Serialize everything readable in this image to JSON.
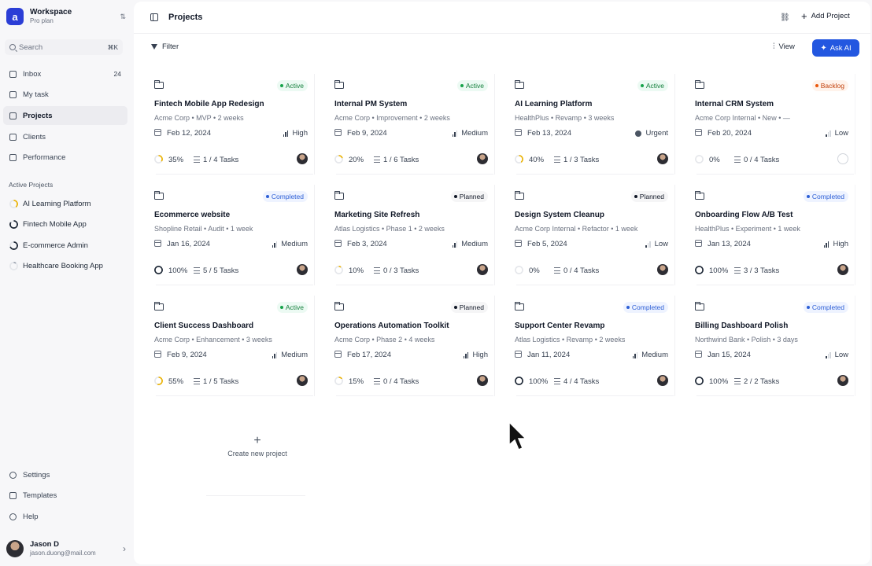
{
  "workspace": {
    "name": "Workspace",
    "plan": "Pro plan"
  },
  "search": {
    "placeholder": "Search",
    "shortcut": "⌘K"
  },
  "nav": [
    {
      "label": "Inbox",
      "count": "24",
      "icon": "inbox-icon"
    },
    {
      "label": "My task",
      "count": "",
      "icon": "checkbox-icon"
    },
    {
      "label": "Projects",
      "count": "",
      "icon": "folder-icon",
      "active": true
    },
    {
      "label": "Clients",
      "count": "",
      "icon": "users-icon"
    },
    {
      "label": "Performance",
      "count": "",
      "icon": "chart-icon"
    }
  ],
  "active_projects": {
    "label": "Active Projects",
    "items": [
      {
        "label": "AI Learning Platform",
        "progress": 0.4,
        "color": "#eab308"
      },
      {
        "label": "Fintech Mobile App",
        "progress": 0.85,
        "color": "#1f2937"
      },
      {
        "label": "E-commerce Admin",
        "progress": 0.7,
        "color": "#1f2937"
      },
      {
        "label": "Healthcare Booking App",
        "progress": 0.1,
        "color": "#9ca3af"
      }
    ]
  },
  "bottom_nav": [
    {
      "label": "Settings",
      "icon": "gear-icon"
    },
    {
      "label": "Templates",
      "icon": "template-icon"
    },
    {
      "label": "Help",
      "icon": "help-icon"
    }
  ],
  "user": {
    "name": "Jason D",
    "email": "jason.duong@mail.com"
  },
  "topbar": {
    "title": "Projects",
    "add_label": "Add Project"
  },
  "toolbar": {
    "filter_label": "Filter",
    "view_label": "View",
    "ask_ai_label": "Ask AI"
  },
  "projects": [
    {
      "title": "Fintech Mobile App Redesign",
      "meta": "Acme Corp • MVP • 2 weeks",
      "status": "Active",
      "date": "Feb 12, 2024",
      "priority": "High",
      "progress": "35%",
      "progress_value": 0.35,
      "ring_color": "#eab308",
      "tasks": "1 / 4 Tasks",
      "avatar": true
    },
    {
      "title": "Internal PM System",
      "meta": "Acme Corp • Improvement • 2 weeks",
      "status": "Active",
      "date": "Feb 9, 2024",
      "priority": "Medium",
      "progress": "20%",
      "progress_value": 0.2,
      "ring_color": "#eab308",
      "tasks": "1 / 6 Tasks",
      "avatar": true
    },
    {
      "title": "AI Learning Platform",
      "meta": "HealthPlus • Revamp • 3 weeks",
      "status": "Active",
      "date": "Feb 13, 2024",
      "priority": "Urgent",
      "progress": "40%",
      "progress_value": 0.4,
      "ring_color": "#eab308",
      "tasks": "1 / 3 Tasks",
      "avatar": true
    },
    {
      "title": "Internal CRM System",
      "meta": "Acme Corp Internal • New • —",
      "status": "Backlog",
      "date": "Feb 20, 2024",
      "priority": "Low",
      "progress": "0%",
      "progress_value": 0,
      "ring_color": "#9ca3af",
      "tasks": "0 / 4 Tasks",
      "avatar": false
    },
    {
      "title": "Ecommerce website",
      "meta": "Shopline Retail • Audit • 1 week",
      "status": "Completed",
      "date": "Jan 16, 2024",
      "priority": "Medium",
      "progress": "100%",
      "progress_value": 1,
      "ring_color": "#1f2937",
      "tasks": "5 / 5 Tasks",
      "avatar": true
    },
    {
      "title": "Marketing Site Refresh",
      "meta": "Atlas Logistics • Phase 1 • 2 weeks",
      "status": "Planned",
      "date": "Feb 3, 2024",
      "priority": "Medium",
      "progress": "10%",
      "progress_value": 0.1,
      "ring_color": "#eab308",
      "tasks": "0 / 3 Tasks",
      "avatar": true
    },
    {
      "title": "Design System Cleanup",
      "meta": "Acme Corp Internal • Refactor • 1 week",
      "status": "Planned",
      "date": "Feb 5, 2024",
      "priority": "Low",
      "progress": "0%",
      "progress_value": 0,
      "ring_color": "#9ca3af",
      "tasks": "0 / 4 Tasks",
      "avatar": true
    },
    {
      "title": "Onboarding Flow A/B Test",
      "meta": "HealthPlus • Experiment • 1 week",
      "status": "Completed",
      "date": "Jan 13, 2024",
      "priority": "High",
      "progress": "100%",
      "progress_value": 1,
      "ring_color": "#1f2937",
      "tasks": "3 / 3 Tasks",
      "avatar": true
    },
    {
      "title": "Client Success Dashboard",
      "meta": "Acme Corp • Enhancement • 3 weeks",
      "status": "Active",
      "date": "Feb 9, 2024",
      "priority": "Medium",
      "progress": "55%",
      "progress_value": 0.55,
      "ring_color": "#eab308",
      "tasks": "1 / 5 Tasks",
      "avatar": true
    },
    {
      "title": "Operations Automation Toolkit",
      "meta": "Acme Corp • Phase 2 • 4 weeks",
      "status": "Planned",
      "date": "Feb 17, 2024",
      "priority": "High",
      "progress": "15%",
      "progress_value": 0.15,
      "ring_color": "#eab308",
      "tasks": "0 / 4 Tasks",
      "avatar": true
    },
    {
      "title": "Support Center Revamp",
      "meta": "Atlas Logistics • Revamp • 2 weeks",
      "status": "Completed",
      "date": "Jan 11, 2024",
      "priority": "Medium",
      "progress": "100%",
      "progress_value": 1,
      "ring_color": "#1f2937",
      "tasks": "4 / 4 Tasks",
      "avatar": true
    },
    {
      "title": "Billing Dashboard Polish",
      "meta": "Northwind Bank • Polish • 3 days",
      "status": "Completed",
      "date": "Jan 15, 2024",
      "priority": "Low",
      "progress": "100%",
      "progress_value": 1,
      "ring_color": "#1f2937",
      "tasks": "2 / 2 Tasks",
      "avatar": true
    }
  ],
  "create_new": {
    "label": "Create new project"
  }
}
